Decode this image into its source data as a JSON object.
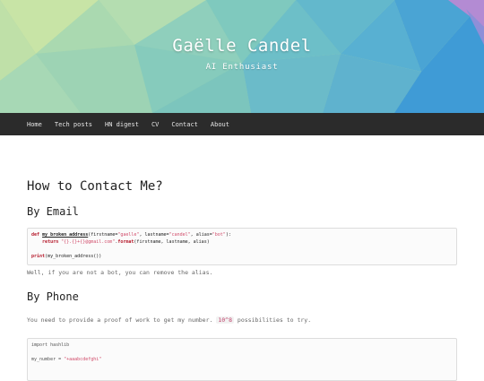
{
  "header": {
    "title": "Gaëlle Candel",
    "subtitle": "AI Enthusiast"
  },
  "nav": {
    "items": [
      "Home",
      "Tech posts",
      "HN digest",
      "CV",
      "Contact",
      "About"
    ]
  },
  "main": {
    "title": "How to Contact Me?",
    "email_heading": "By Email",
    "email_code": {
      "line1_def": "def",
      "line1_fn": "my_broken_address",
      "line1_rest1": "(firstname=",
      "line1_s1": "\"gaelle\"",
      "line1_rest2": ", lastname=",
      "line1_s2": "\"candel\"",
      "line1_rest3": ", alias=",
      "line1_s3": "\"bot\"",
      "line1_end": "):",
      "line2_return": "return",
      "line2_s": "\"{}.{}+{}@gmail.com\"",
      "line2_rest": ".",
      "line2_format": "format",
      "line2_args": "(firstname, lastname, alias)",
      "line4_print": "print",
      "line4_arg": "(my_broken_address())"
    },
    "email_note": "Well, if you are not a bot, you can remove the alias.",
    "phone_heading": "By Phone",
    "phone_text_before": "You need to provide a proof of work to get my number.",
    "phone_inline": "10^8",
    "phone_text_after": "possibilities to try.",
    "phone_code": {
      "line1": "import hashlib",
      "line3_var": "my_number = ",
      "line3_s": "\"+aaabcdefghi\""
    }
  },
  "colors": {
    "navbar": "#2b2b2b",
    "accent_string": "#d14c6a",
    "keyword": "#b5192a"
  }
}
